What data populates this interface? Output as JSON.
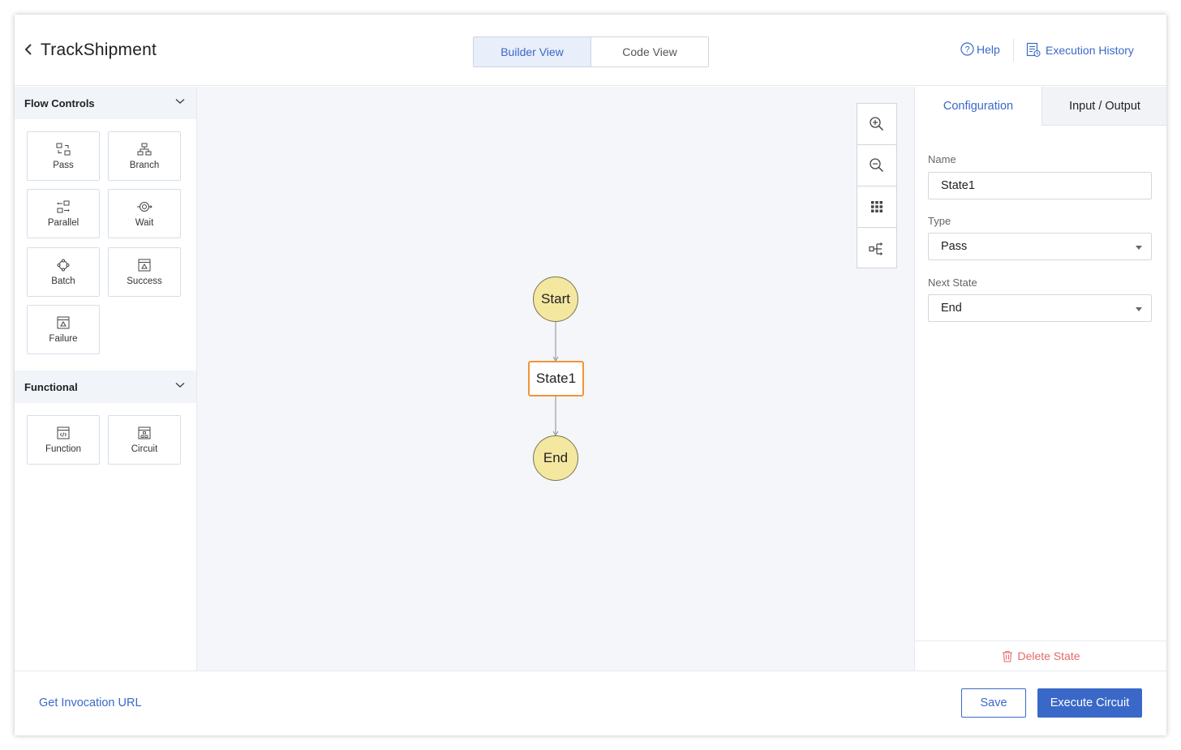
{
  "header": {
    "title": "TrackShipment",
    "views": [
      {
        "label": "Builder View",
        "active": true
      },
      {
        "label": "Code View",
        "active": false
      }
    ],
    "help_label": "Help",
    "history_label": "Execution History"
  },
  "sidebar": {
    "flow_controls": {
      "title": "Flow Controls",
      "items": [
        {
          "label": "Pass",
          "icon": "pass-icon"
        },
        {
          "label": "Branch",
          "icon": "branch-icon"
        },
        {
          "label": "Parallel",
          "icon": "parallel-icon"
        },
        {
          "label": "Wait",
          "icon": "wait-icon"
        },
        {
          "label": "Batch",
          "icon": "batch-icon"
        },
        {
          "label": "Success",
          "icon": "success-icon"
        },
        {
          "label": "Failure",
          "icon": "failure-icon"
        }
      ]
    },
    "functional": {
      "title": "Functional",
      "items": [
        {
          "label": "Function",
          "icon": "function-icon"
        },
        {
          "label": "Circuit",
          "icon": "circuit-icon"
        }
      ]
    }
  },
  "canvas": {
    "nodes": [
      {
        "label": "Start",
        "kind": "terminal"
      },
      {
        "label": "State1",
        "kind": "state",
        "selected": true
      },
      {
        "label": "End",
        "kind": "terminal"
      }
    ],
    "tools": [
      "zoom-in-icon",
      "zoom-out-icon",
      "grid-icon",
      "layout-icon"
    ]
  },
  "config": {
    "tabs": [
      {
        "label": "Configuration",
        "active": true
      },
      {
        "label": "Input / Output",
        "active": false
      }
    ],
    "name_label": "Name",
    "name_value": "State1",
    "type_label": "Type",
    "type_value": "Pass",
    "next_label": "Next State",
    "next_value": "End",
    "delete_label": "Delete State"
  },
  "footer": {
    "invoke_label": "Get Invocation URL",
    "save_label": "Save",
    "execute_label": "Execute Circuit"
  },
  "colors": {
    "accent": "#3a68c8",
    "node_fill": "#f4e7a0",
    "selected_border": "#f0953a",
    "danger": "#e26a6a"
  }
}
